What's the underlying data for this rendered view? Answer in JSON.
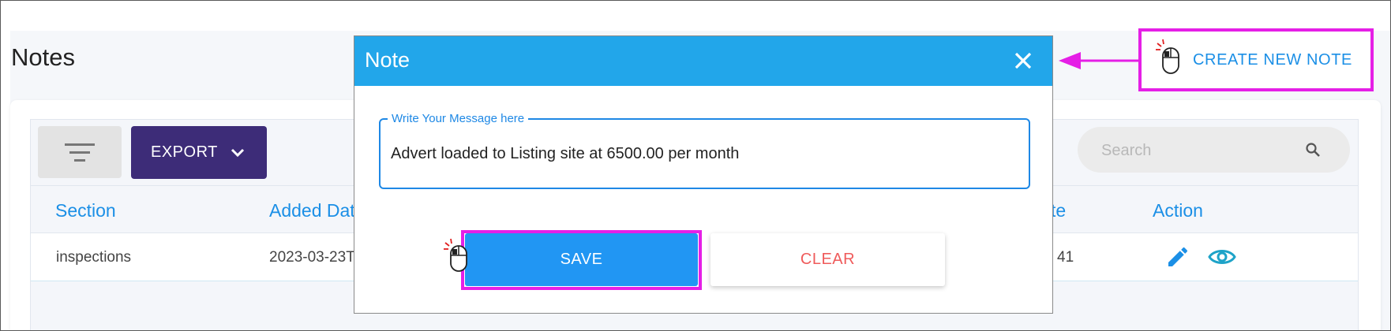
{
  "page": {
    "title": "Notes"
  },
  "toolbar": {
    "export_label": "EXPORT",
    "search_placeholder": "Search"
  },
  "table": {
    "columns": [
      "Section",
      "Added Dat",
      "te",
      "Action"
    ],
    "rows": [
      {
        "section": "inspections",
        "added_date": "2023-03-23T",
        "date": "41"
      }
    ]
  },
  "create_note": {
    "label": "CREATE NEW NOTE"
  },
  "modal": {
    "title": "Note",
    "field_label": "Write Your Message here",
    "field_value": "Advert loaded to Listing site at 6500.00 per month",
    "save_label": "SAVE",
    "clear_label": "CLEAR"
  },
  "colors": {
    "modal_header": "#22a6ea",
    "primary": "#2196f3",
    "export_button": "#3d2c78",
    "highlight": "#e51fe6",
    "clear_text": "#ef5b5b",
    "link_blue": "#1b8fe6"
  },
  "icons": {
    "filter": "filter-lines-icon",
    "export_chevron": "chevron-down-icon",
    "search": "search-icon",
    "edit": "pencil-icon",
    "view": "eye-icon",
    "close": "close-icon",
    "cursor": "mouse-click-icon",
    "arrow": "arrow-left-icon"
  }
}
